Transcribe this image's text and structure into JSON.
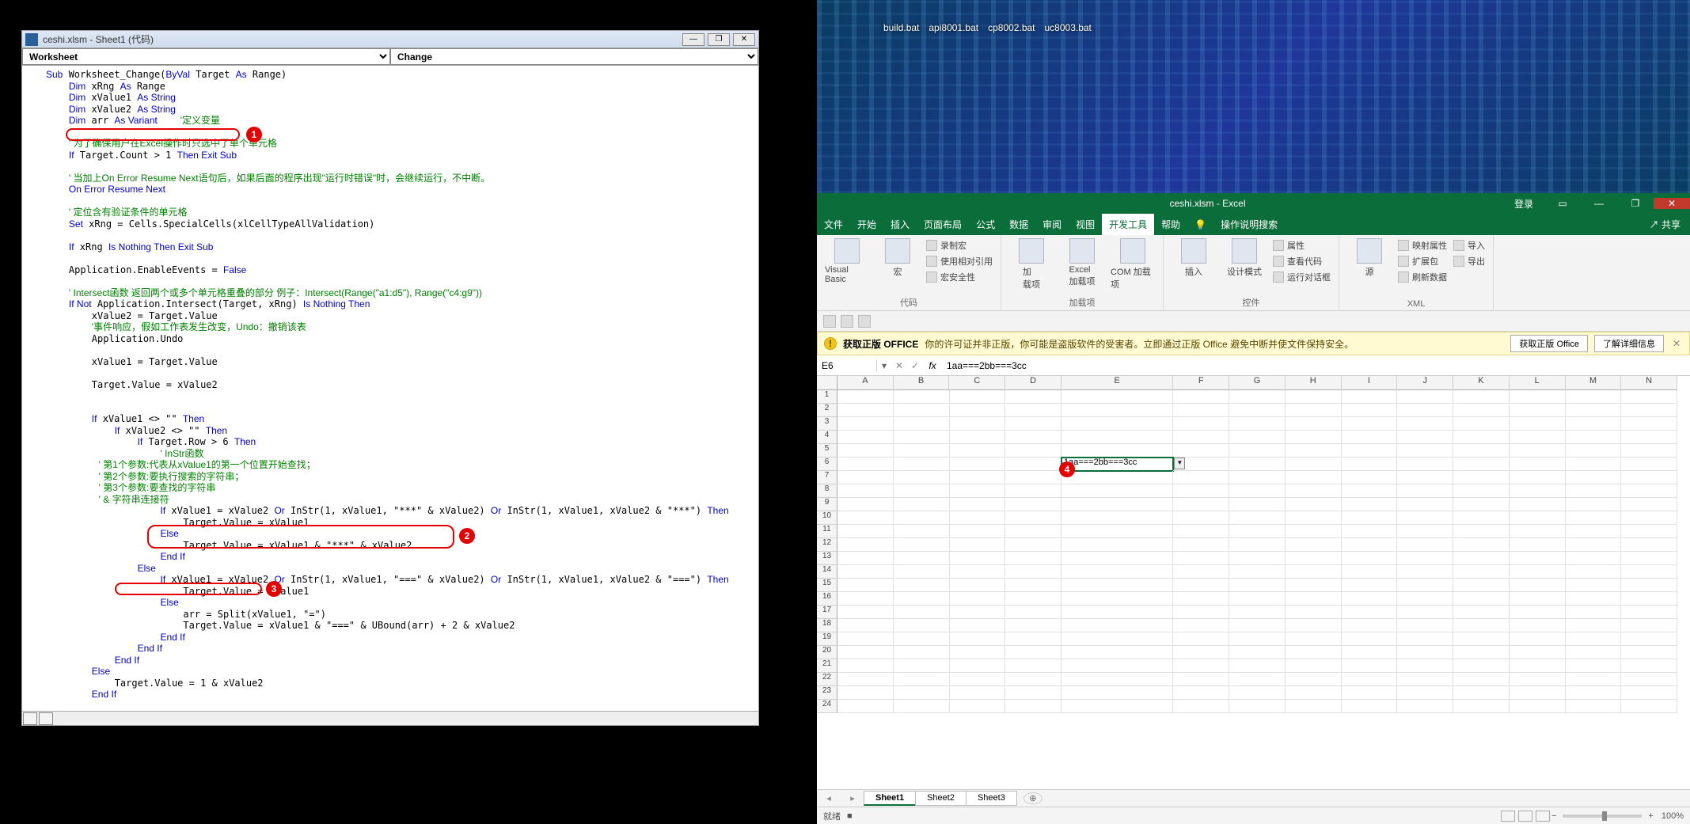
{
  "vba": {
    "title": "ceshi.xlsm - Sheet1 (代码)",
    "combo_left": "Worksheet",
    "combo_right": "Change",
    "winbtns": {
      "min": "—",
      "max": "❐",
      "close": "✕"
    },
    "callouts": {
      "b1": "1",
      "b2": "2",
      "b3": "3"
    },
    "code_html": "<span class=\"kw\">Sub</span> Worksheet_Change(<span class=\"kw\">ByVal</span> Target <span class=\"kw\">As</span> Range)\n    <span class=\"kw\">Dim</span> xRng <span class=\"kw\">As</span> Range\n    <span class=\"kw\">Dim</span> xValue1 <span class=\"kw\">As String</span>\n    <span class=\"kw\">Dim</span> xValue2 <span class=\"kw\">As String</span>\n    <span class=\"kw\">Dim</span> arr <span class=\"kw\">As Variant</span>    <span class=\"cm\">'定义变量</span>\n\n    <span class=\"cm\">' 为了确保用户在Excel操作时只选中了单个单元格</span>\n    <span class=\"kw\">If</span> Target.Count &gt; 1 <span class=\"kw\">Then Exit Sub</span>\n\n    <span class=\"cm\">' 当加上On Error Resume Next语句后，如果后面的程序出现\"运行时错误\"时，会继续运行，不中断。</span>\n    <span class=\"kw\">On Error Resume Next</span>\n\n    <span class=\"cm\">' 定位含有验证条件的单元格</span>\n    <span class=\"kw\">Set</span> xRng = Cells.SpecialCells(xlCellTypeAllValidation)\n\n    <span class=\"kw\">If</span> xRng <span class=\"kw\">Is Nothing Then Exit Sub</span>\n\n    Application.EnableEvents = <span class=\"kw\">False</span>\n\n    <span class=\"cm\">' Intersect函数 返回两个或多个单元格重叠的部分 例子：Intersect(Range(\"a1:d5\"), Range(\"c4:g9\"))</span>\n    <span class=\"kw\">If Not</span> Application.Intersect(Target, xRng) <span class=\"kw\">Is Nothing Then</span>\n        xValue2 = Target.Value\n        <span class=\"cm\">'事件响应，假如工作表发生改变，Undo：撤销该表</span>\n        Application.Undo\n\n        xValue1 = Target.Value\n\n        Target.Value = xValue2\n\n\n        <span class=\"kw\">If</span> xValue1 &lt;&gt; \"\" <span class=\"kw\">Then</span>\n            <span class=\"kw\">If</span> xValue2 &lt;&gt; \"\" <span class=\"kw\">Then</span>\n                <span class=\"kw\">If</span> Target.Row &gt; 6 <span class=\"kw\">Then</span>\n                    <span class=\"cm\">' InStr函数\n                    ' 第1个参数:代表从xValue1的第一个位置开始查找；\n                    ' 第2个参数:要执行搜索的字符串；\n                    ' 第3个参数:要查找的字符串\n                    ' &amp; 字符串连接符</span>\n                    <span class=\"kw\">If</span> xValue1 = xValue2 <span class=\"kw\">Or</span> InStr(1, xValue1, \"***\" &amp; xValue2) <span class=\"kw\">Or</span> InStr(1, xValue1, xValue2 &amp; \"***\") <span class=\"kw\">Then</span>\n                        Target.Value = xValue1\n                    <span class=\"kw\">Else</span>\n                        Target.Value = xValue1 &amp; \"***\" &amp; xValue2\n                    <span class=\"kw\">End If</span>\n                <span class=\"kw\">Else</span>\n                    <span class=\"kw\">If</span> xValue1 = xValue2 <span class=\"kw\">Or</span> InStr(1, xValue1, \"===\" &amp; xValue2) <span class=\"kw\">Or</span> InStr(1, xValue1, xValue2 &amp; \"===\") <span class=\"kw\">Then</span>\n                        Target.Value = xValue1\n                    <span class=\"kw\">Else</span>\n                        arr = Split(xValue1, \"=\")\n                        Target.Value = xValue1 &amp; \"===\" &amp; UBound(arr) + 2 &amp; xValue2\n                    <span class=\"kw\">End If</span>\n                <span class=\"kw\">End If</span>\n            <span class=\"kw\">End If</span>\n        <span class=\"kw\">Else</span>\n            Target.Value = 1 &amp; xValue2\n        <span class=\"kw\">End If</span>\n\n\n    <span class=\"kw\">End If</span>\n\n\n    Application.EnableEvents = <span class=\"kw\">True</span>\n\n<span class=\"kw\">End Sub</span>"
  },
  "excel": {
    "desktop_files": [
      "build.bat",
      "api8001.bat",
      "cp8002.bat",
      "uc8003.bat"
    ],
    "app_title": "ceshi.xlsm - Excel",
    "appbar": {
      "login": "登录",
      "min": "—",
      "max": "❐",
      "close": "✕"
    },
    "tabs": [
      "文件",
      "开始",
      "插入",
      "页面布局",
      "公式",
      "数据",
      "审阅",
      "视图",
      "开发工具",
      "帮助"
    ],
    "active_tab": "开发工具",
    "tell_me": "操作说明搜索",
    "share": "共享",
    "ribbon": {
      "g1": {
        "cap": "代码",
        "vb": "Visual Basic",
        "macro": "宏",
        "rec": "录制宏",
        "rel": "使用相对引用",
        "sec": "宏安全性"
      },
      "g2": {
        "cap": "加载项",
        "a1": "加\n载项",
        "a2": "Excel\n加载项",
        "a3": "COM 加载项"
      },
      "g3": {
        "cap": "控件",
        "ins": "插入",
        "design": "设计模式",
        "prop": "属性",
        "view": "查看代码",
        "dlg": "运行对话框"
      },
      "g4": {
        "cap": "XML",
        "src": "源",
        "map": "映射属性",
        "exp": "扩展包",
        "ref": "刷新数据",
        "imp": "导入",
        "out": "导出"
      }
    },
    "msgbar": {
      "title": "获取正版 OFFICE",
      "msg": "你的许可证并非正版，你可能是盗版软件的受害者。立即通过正版 Office 避免中断并使文件保持安全。",
      "btn1": "获取正版 Office",
      "btn2": "了解详细信息"
    },
    "namebox": "E6",
    "formula": "1aa===2bb===3cc",
    "columns": [
      "A",
      "B",
      "C",
      "D",
      "E",
      "F",
      "G",
      "H",
      "I",
      "J",
      "K",
      "L",
      "M",
      "N"
    ],
    "rows": [
      "1",
      "2",
      "3",
      "4",
      "5",
      "6",
      "7",
      "8",
      "9",
      "10",
      "11",
      "12",
      "13",
      "14",
      "15",
      "16",
      "17",
      "18",
      "19",
      "20",
      "21",
      "22",
      "23",
      "24"
    ],
    "cell_e6": "1aa===2bb===3cc",
    "callout4": "4",
    "sheets": [
      "Sheet1",
      "Sheet2",
      "Sheet3"
    ],
    "active_sheet": "Sheet1",
    "status": {
      "ready": "就绪",
      "rec": "■",
      "zoom": "100%",
      "plus": "+",
      "minus": "−"
    }
  }
}
